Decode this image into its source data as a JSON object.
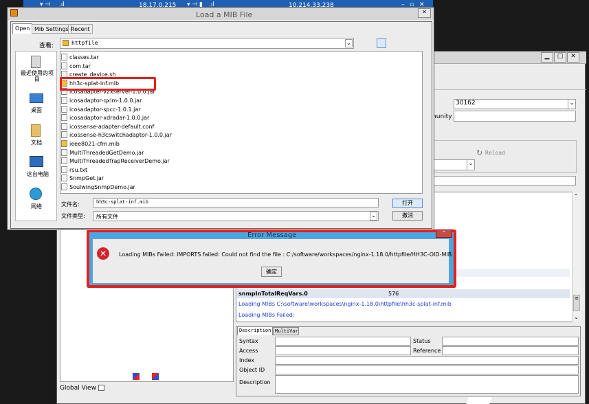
{
  "remote_bar_1": {
    "address": "18.17.0.215"
  },
  "remote_bar_2": {
    "address": "10.214.33.238"
  },
  "load_dialog": {
    "title": "Load a MIB File",
    "tabs": [
      "Open",
      "Mib Settings",
      "Recent"
    ],
    "look_in_label": "查看:",
    "look_in_value": "httpfile",
    "places": [
      "最近使用的项目",
      "桌面",
      "文档",
      "这台电脑",
      "网络"
    ],
    "files": [
      "classes.tar",
      "com.tar",
      "create_device.sh",
      "hh3c-splat-inf.mib",
      "icosadapter-v2xserver-1.0.0.jar",
      "icosadaptor-qxlm-1.0.0.jar",
      "icosadaptor-spcc-1.0.1.jar",
      "icosadaptor-xdradar-1.0.0.jar",
      "icossense-adapter-default.conf",
      "icossense-h3cswitchadaptor-1.0.0.jar",
      "ieee8021-cfm.mib",
      "MultiThreadedGetDemo.jar",
      "MultiThreadedTrapReceiverDemo.jar",
      "rsu.txt",
      "SnmpGet.jar",
      "SoulwingSnmpDemo.jar"
    ],
    "filename_label": "文件名:",
    "filename_value": "hh3c-splat-inf.mib",
    "filetype_label": "文件类型:",
    "filetype_value": "所有文件",
    "open_button": "打开",
    "cancel_button": "撤消"
  },
  "main_window": {
    "port_value": "30162",
    "community_label": "munity",
    "reload_label": "Reload",
    "tree_row_name": "snmpInTotalReqVars.0",
    "tree_row_value": "576",
    "log_line_1": "Loading MIBs C:\\software\\workspaces\\nginx-1.18.0\\httpfile\\hh3c-splat-inf.mib",
    "log_line_2": "Loading MIBs Failed:",
    "desc_tabs": [
      "Description",
      "MultiVar"
    ],
    "desc_fields": {
      "syntax": "Syntax",
      "access": "Access",
      "index": "Index",
      "object_id": "Object ID",
      "description": "Description",
      "status": "Status",
      "reference": "Reference"
    },
    "global_view": "Global View"
  },
  "error_dialog": {
    "title": "Error Message",
    "message": "Loading MIBs Failed: IMPORTS failed: Could not find the file : C:/software/workspaces/nginx-1.18.0/httpfile/HH3C-OID-MIB",
    "ok_button": "确定"
  },
  "colors": {
    "highlight": "#e8201c",
    "remote_bar": "#1f5fb4",
    "error_title": "#4aa6e0"
  }
}
